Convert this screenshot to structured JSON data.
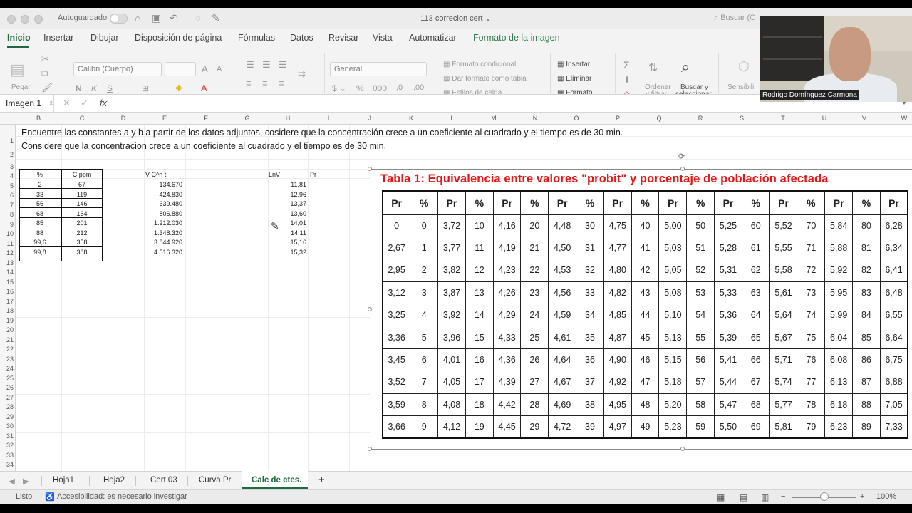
{
  "titlebar": {
    "autosave_label": "Autoguardado",
    "document_title": "113 correcion cert",
    "search_placeholder": "Buscar (C"
  },
  "tabs": [
    "Inicio",
    "Insertar",
    "Dibujar",
    "Disposición de página",
    "Fórmulas",
    "Datos",
    "Revisar",
    "Vista",
    "Automatizar",
    "Formato de la imagen"
  ],
  "ribbon": {
    "paste": "Pegar",
    "font_name": "Calibri (Cuerpo)",
    "number_format": "General",
    "conditional_format": "Formato condicional",
    "format_as_table": "Dar formato como tabla",
    "cell_styles": "Estilos de celda",
    "insert": "Insertar",
    "delete": "Eliminar",
    "format": "Formato",
    "sort_filter_1": "Ordenar",
    "sort_filter_2": "y filtrar",
    "find_select_1": "Buscar y",
    "find_select_2": "seleccionar",
    "sensitivity": "Sensibili"
  },
  "formula_bar": {
    "name_box": "Imagen 1",
    "fx": "fx"
  },
  "columns": [
    "B",
    "C",
    "D",
    "E",
    "F",
    "G",
    "H",
    "I",
    "J",
    "K",
    "L",
    "M",
    "N",
    "O",
    "P",
    "Q",
    "R",
    "S",
    "T",
    "U",
    "V",
    "W"
  ],
  "rows": [
    "1",
    "2",
    "3",
    "4",
    "5",
    "6",
    "7",
    "8",
    "9",
    "10",
    "11",
    "12",
    "13",
    "14",
    "15",
    "16",
    "17",
    "18",
    "19",
    "20",
    "21",
    "22",
    "23",
    "24",
    "25",
    "26",
    "27",
    "28",
    "29",
    "30",
    "31",
    "32",
    "33",
    "34",
    "35"
  ],
  "sheet": {
    "line1": "Encuentre las constantes a y b a partir de los datos adjuntos, cosidere que la concentración crece a un coeficiente al cuadrado y el tiempo es de 30 min.",
    "line2": "Considere que la concentracion crece a un coeficiente al cuadrado y el tiempo es de 30 min.",
    "hdr_pct": "%",
    "hdr_cppm": "C ppm",
    "hdr_vcnt": "V C^n t",
    "hdr_lnv": "LnV",
    "hdr_pr": "Pr",
    "data": [
      {
        "pct": "2",
        "c": "67",
        "v": "134.670",
        "lnv": "11,81"
      },
      {
        "pct": "33",
        "c": "119",
        "v": "424.830",
        "lnv": "12,96"
      },
      {
        "pct": "56",
        "c": "146",
        "v": "639.480",
        "lnv": "13,37"
      },
      {
        "pct": "68",
        "c": "164",
        "v": "806.880",
        "lnv": "13,60"
      },
      {
        "pct": "85",
        "c": "201",
        "v": "1.212.030",
        "lnv": "14,01"
      },
      {
        "pct": "88",
        "c": "212",
        "v": "1.348.320",
        "lnv": "14,11"
      },
      {
        "pct": "99,6",
        "c": "358",
        "v": "3.844.920",
        "lnv": "15,16"
      },
      {
        "pct": "99,8",
        "c": "388",
        "v": "4.516.320",
        "lnv": "15,32"
      }
    ]
  },
  "image": {
    "title": "Tabla 1: Equivalencia entre valores \"probit\" y porcentaje de población afectada",
    "headers": [
      "Pr",
      "%",
      "Pr",
      "%",
      "Pr",
      "%",
      "Pr",
      "%",
      "Pr",
      "%",
      "Pr",
      "%",
      "Pr",
      "%",
      "Pr",
      "%",
      "Pr",
      "%",
      "Pr"
    ],
    "rows": [
      [
        "0",
        "0",
        "3,72",
        "10",
        "4,16",
        "20",
        "4,48",
        "30",
        "4,75",
        "40",
        "5,00",
        "50",
        "5,25",
        "60",
        "5,52",
        "70",
        "5,84",
        "80",
        "6,28"
      ],
      [
        "2,67",
        "1",
        "3,77",
        "11",
        "4,19",
        "21",
        "4,50",
        "31",
        "4,77",
        "41",
        "5,03",
        "51",
        "5,28",
        "61",
        "5,55",
        "71",
        "5,88",
        "81",
        "6,34"
      ],
      [
        "2,95",
        "2",
        "3,82",
        "12",
        "4,23",
        "22",
        "4,53",
        "32",
        "4,80",
        "42",
        "5,05",
        "52",
        "5,31",
        "62",
        "5,58",
        "72",
        "5,92",
        "82",
        "6,41"
      ],
      [
        "3,12",
        "3",
        "3,87",
        "13",
        "4,26",
        "23",
        "4,56",
        "33",
        "4,82",
        "43",
        "5,08",
        "53",
        "5,33",
        "63",
        "5,61",
        "73",
        "5,95",
        "83",
        "6,48"
      ],
      [
        "3,25",
        "4",
        "3,92",
        "14",
        "4,29",
        "24",
        "4,59",
        "34",
        "4,85",
        "44",
        "5,10",
        "54",
        "5,36",
        "64",
        "5,64",
        "74",
        "5,99",
        "84",
        "6,55"
      ],
      [
        "3,36",
        "5",
        "3,96",
        "15",
        "4,33",
        "25",
        "4,61",
        "35",
        "4,87",
        "45",
        "5,13",
        "55",
        "5,39",
        "65",
        "5,67",
        "75",
        "6,04",
        "85",
        "6,64"
      ],
      [
        "3,45",
        "6",
        "4,01",
        "16",
        "4,36",
        "26",
        "4,64",
        "36",
        "4,90",
        "46",
        "5,15",
        "56",
        "5,41",
        "66",
        "5,71",
        "76",
        "6,08",
        "86",
        "6,75"
      ],
      [
        "3,52",
        "7",
        "4,05",
        "17",
        "4,39",
        "27",
        "4,67",
        "37",
        "4,92",
        "47",
        "5,18",
        "57",
        "5,44",
        "67",
        "5,74",
        "77",
        "6,13",
        "87",
        "6,88"
      ],
      [
        "3,59",
        "8",
        "4,08",
        "18",
        "4,42",
        "28",
        "4,69",
        "38",
        "4,95",
        "48",
        "5,20",
        "58",
        "5,47",
        "68",
        "5,77",
        "78",
        "6,18",
        "88",
        "7,05"
      ],
      [
        "3,66",
        "9",
        "4,12",
        "19",
        "4,45",
        "29",
        "4,72",
        "39",
        "4,97",
        "49",
        "5,23",
        "59",
        "5,50",
        "69",
        "5,81",
        "79",
        "6,23",
        "89",
        "7,33"
      ]
    ]
  },
  "sheet_tabs": [
    "Hoja1",
    "Hoja2",
    "Cert 03",
    "Curva Pr",
    "Calc de ctes."
  ],
  "status": {
    "ready": "Listo",
    "accessibility": "Accesibilidad: es necesario investigar",
    "zoom": "100%"
  },
  "webcam": {
    "name": "Rodrigo Domínguez Carmona"
  }
}
